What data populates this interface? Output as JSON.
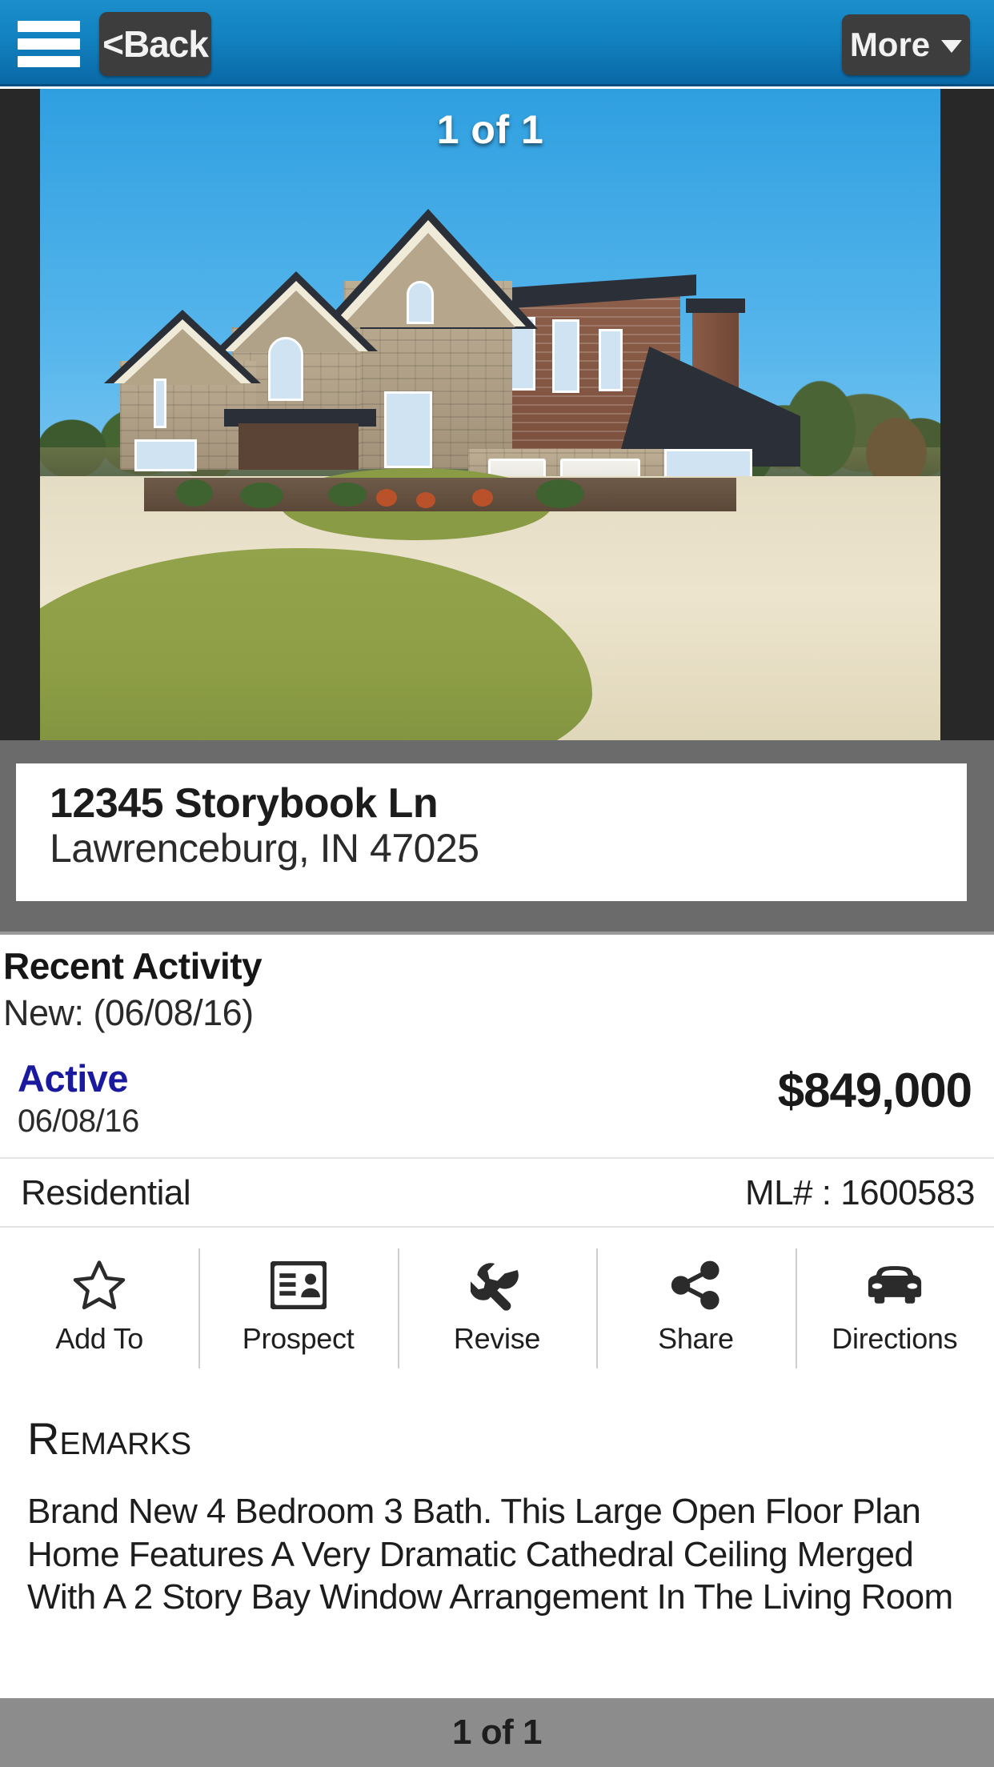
{
  "header": {
    "menu_icon": "hamburger-menu-icon",
    "back_label": "<Back",
    "more_label": "More",
    "more_caret": "chevron-down-icon"
  },
  "photo": {
    "counter": "1 of 1",
    "alt": "two-story brick and stone house with dark gabled roof and paved circular driveway"
  },
  "address": {
    "street": "12345 Storybook Ln",
    "city_state_zip": "Lawrenceburg, IN 47025"
  },
  "recent_activity": {
    "title": "Recent Activity",
    "subtitle": "New: (06/08/16)",
    "status": "Active",
    "status_date": "06/08/16",
    "price": "$849,000",
    "status_color": "#1a1a9e"
  },
  "details": {
    "property_type": "Residential",
    "ml_number": "ML# : 1600583"
  },
  "toolbar": {
    "items": [
      {
        "label": "Add To",
        "icon": "star-outline-icon"
      },
      {
        "label": "Prospect",
        "icon": "contact-card-icon"
      },
      {
        "label": "Revise",
        "icon": "wrench-icon"
      },
      {
        "label": "Share",
        "icon": "share-nodes-icon"
      },
      {
        "label": "Directions",
        "icon": "car-front-icon"
      }
    ]
  },
  "remarks": {
    "title": "Remarks",
    "body": "Brand New 4 Bedroom 3 Bath. This Large Open Floor Plan Home Features A Very Dramatic Cathedral Ceiling Merged With A 2 Story Bay Window Arrangement In The Living Room"
  },
  "footer": {
    "counter": "1 of 1"
  }
}
